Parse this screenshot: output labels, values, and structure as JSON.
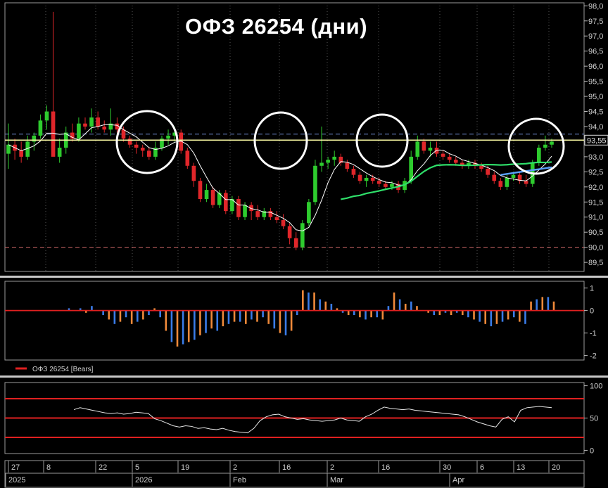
{
  "chart_data": {
    "title": "ОФЗ 26254 (дни)",
    "type": "candlestick",
    "price_panel": {
      "y_ticks": [
        "98,0",
        "97,5",
        "97,0",
        "96,5",
        "96,0",
        "95,5",
        "95,0",
        "94,5",
        "94,0",
        "93,5",
        "93,0",
        "92,5",
        "92,0",
        "91,5",
        "91,0",
        "90,5",
        "90,0",
        "89,5"
      ],
      "last_price_label": "93,55",
      "ylim": [
        89.2,
        98.1
      ],
      "resistance_level": 93.55,
      "dashed_levels": [
        93.75,
        90.0
      ],
      "candles": [
        [
          93.1,
          94.1,
          92.6,
          93.4
        ],
        [
          93.4,
          93.6,
          92.9,
          93.2
        ],
        [
          93.2,
          93.5,
          92.8,
          93.0
        ],
        [
          93.0,
          93.7,
          92.9,
          93.5
        ],
        [
          93.5,
          93.8,
          93.2,
          93.7
        ],
        [
          93.7,
          94.4,
          93.6,
          94.2
        ],
        [
          94.2,
          94.7,
          93.9,
          94.5
        ],
        [
          94.5,
          97.8,
          93.8,
          93.0
        ],
        [
          93.0,
          93.6,
          92.8,
          93.3
        ],
        [
          93.3,
          94.0,
          93.1,
          93.8
        ],
        [
          93.8,
          94.1,
          93.5,
          93.6
        ],
        [
          93.6,
          94.3,
          93.5,
          94.1
        ],
        [
          94.1,
          94.3,
          93.9,
          94.0
        ],
        [
          94.0,
          94.6,
          93.8,
          94.3
        ],
        [
          94.3,
          94.5,
          93.9,
          94.0
        ],
        [
          94.0,
          94.2,
          93.8,
          93.9
        ],
        [
          93.9,
          94.6,
          93.7,
          94.1
        ],
        [
          94.1,
          94.3,
          93.8,
          93.9
        ],
        [
          93.9,
          94.0,
          93.5,
          93.6
        ],
        [
          93.6,
          93.7,
          93.3,
          93.4
        ],
        [
          93.4,
          93.5,
          93.1,
          93.3
        ],
        [
          93.3,
          93.4,
          93.0,
          93.2
        ],
        [
          93.2,
          93.3,
          92.9,
          93.0
        ],
        [
          93.0,
          93.5,
          92.9,
          93.3
        ],
        [
          93.3,
          93.7,
          93.2,
          93.6
        ],
        [
          93.6,
          93.9,
          93.4,
          93.7
        ],
        [
          93.7,
          94.0,
          93.5,
          93.8
        ],
        [
          93.8,
          93.9,
          93.1,
          93.2
        ],
        [
          93.2,
          93.3,
          92.6,
          92.7
        ],
        [
          92.7,
          92.8,
          92.0,
          92.2
        ],
        [
          92.2,
          92.3,
          91.5,
          91.6
        ],
        [
          91.6,
          92.1,
          91.5,
          91.9
        ],
        [
          91.9,
          92.0,
          91.3,
          91.4
        ],
        [
          91.4,
          91.9,
          91.3,
          91.8
        ],
        [
          91.8,
          91.9,
          91.1,
          91.2
        ],
        [
          91.2,
          91.7,
          91.1,
          91.6
        ],
        [
          91.6,
          91.7,
          90.9,
          91.0
        ],
        [
          91.0,
          91.5,
          90.9,
          91.4
        ],
        [
          91.4,
          91.5,
          90.9,
          91.2
        ],
        [
          91.2,
          91.4,
          90.9,
          91.0
        ],
        [
          91.0,
          91.3,
          90.9,
          91.2
        ],
        [
          91.2,
          91.3,
          90.9,
          91.0
        ],
        [
          91.0,
          91.2,
          90.8,
          90.9
        ],
        [
          90.9,
          91.1,
          90.6,
          90.7
        ],
        [
          90.7,
          90.8,
          90.1,
          90.3
        ],
        [
          90.3,
          90.5,
          89.9,
          90.0
        ],
        [
          90.0,
          90.9,
          89.9,
          90.8
        ],
        [
          90.8,
          91.6,
          90.7,
          91.5
        ],
        [
          91.5,
          92.9,
          91.4,
          92.7
        ],
        [
          92.7,
          94.0,
          92.5,
          92.8
        ],
        [
          92.8,
          93.0,
          92.6,
          92.9
        ],
        [
          92.9,
          93.2,
          92.7,
          93.0
        ],
        [
          93.0,
          93.1,
          92.7,
          92.8
        ],
        [
          92.8,
          92.9,
          92.5,
          92.6
        ],
        [
          92.6,
          92.7,
          92.3,
          92.4
        ],
        [
          92.4,
          92.5,
          92.1,
          92.2
        ],
        [
          92.2,
          92.4,
          92.0,
          92.3
        ],
        [
          92.3,
          92.4,
          92.1,
          92.2
        ],
        [
          92.2,
          92.3,
          92.0,
          92.1
        ],
        [
          92.1,
          92.2,
          91.9,
          92.0
        ],
        [
          92.0,
          92.2,
          91.9,
          92.1
        ],
        [
          92.1,
          92.2,
          91.8,
          91.9
        ],
        [
          91.9,
          92.3,
          91.8,
          92.2
        ],
        [
          92.2,
          93.2,
          92.1,
          93.0
        ],
        [
          93.0,
          93.7,
          92.9,
          93.5
        ],
        [
          93.5,
          93.6,
          93.1,
          93.2
        ],
        [
          93.2,
          93.5,
          93.0,
          93.3
        ],
        [
          93.3,
          93.5,
          93.0,
          93.1
        ],
        [
          93.1,
          93.2,
          92.9,
          93.0
        ],
        [
          93.0,
          93.1,
          92.8,
          92.9
        ],
        [
          92.9,
          93.0,
          92.7,
          92.8
        ],
        [
          92.8,
          92.9,
          92.6,
          92.7
        ],
        [
          92.7,
          92.9,
          92.6,
          92.8
        ],
        [
          92.8,
          92.9,
          92.6,
          92.7
        ],
        [
          92.7,
          92.8,
          92.5,
          92.6
        ],
        [
          92.6,
          92.7,
          92.3,
          92.4
        ],
        [
          92.4,
          92.5,
          92.1,
          92.2
        ],
        [
          92.2,
          92.3,
          91.9,
          92.0
        ],
        [
          92.0,
          92.4,
          91.9,
          92.3
        ],
        [
          92.3,
          92.5,
          92.2,
          92.4
        ],
        [
          92.4,
          92.5,
          92.1,
          92.2
        ],
        [
          92.2,
          92.4,
          92.0,
          92.1
        ],
        [
          92.1,
          92.9,
          92.0,
          92.8
        ],
        [
          92.8,
          93.4,
          92.7,
          93.3
        ],
        [
          93.3,
          93.7,
          93.2,
          93.4
        ],
        [
          93.4,
          93.6,
          93.3,
          93.5
        ]
      ],
      "circled_zones": [
        "Jan",
        "Feb 16",
        "Mar 16",
        "Apr 20"
      ]
    },
    "bears_panel": {
      "legend": "ОФЗ 26254 [Bears]",
      "y_ticks": [
        "1",
        "0",
        "-1",
        "-2"
      ],
      "ylim": [
        -2.2,
        1.3
      ],
      "values": [
        0.1,
        0.0,
        0.1,
        -0.1,
        0.2,
        0.0,
        -0.2,
        -0.4,
        -0.6,
        -0.5,
        -0.3,
        -0.6,
        -0.5,
        -0.4,
        -0.2,
        0.1,
        -0.3,
        -0.9,
        -1.4,
        -1.6,
        -1.5,
        -1.4,
        -1.3,
        -1.1,
        -1.0,
        -0.8,
        -0.9,
        -0.7,
        -0.6,
        -0.5,
        -0.5,
        -0.6,
        -0.4,
        -0.5,
        -0.3,
        -0.6,
        -0.8,
        -1.0,
        -1.1,
        -0.9,
        -0.2,
        0.9,
        0.8,
        0.8,
        0.5,
        0.4,
        0.3,
        0.1,
        -0.1,
        -0.2,
        -0.2,
        -0.3,
        -0.4,
        -0.3,
        -0.3,
        -0.4,
        0.2,
        0.8,
        0.5,
        0.3,
        0.4,
        0.2,
        0.0,
        -0.1,
        -0.2,
        -0.2,
        -0.1,
        -0.2,
        -0.1,
        -0.2,
        -0.3,
        -0.4,
        -0.5,
        -0.6,
        -0.7,
        -0.6,
        -0.5,
        -0.4,
        -0.3,
        -0.5,
        -0.6,
        0.4,
        0.5,
        0.6,
        0.6,
        0.4
      ]
    },
    "rsi_panel": {
      "y_ticks": [
        "100",
        "50",
        "0"
      ],
      "ylim": [
        -5,
        105
      ],
      "levels": [
        80,
        50,
        20
      ],
      "values": [
        63,
        66,
        64,
        62,
        60,
        58,
        57,
        58,
        56,
        57,
        59,
        58,
        57,
        49,
        46,
        42,
        38,
        36,
        38,
        37,
        34,
        35,
        33,
        32,
        34,
        31,
        29,
        28,
        27,
        34,
        46,
        52,
        55,
        56,
        52,
        50,
        48,
        49,
        47,
        46,
        45,
        46,
        47,
        50,
        47,
        46,
        45,
        52,
        56,
        62,
        67,
        65,
        64,
        63,
        64,
        62,
        61,
        60,
        59,
        58,
        57,
        56,
        55,
        52,
        48,
        44,
        41,
        38,
        36,
        48,
        52,
        44,
        62,
        66,
        67,
        68,
        67,
        66
      ]
    },
    "x_axis": {
      "day_ticks": [
        "27",
        "8",
        "22",
        "5",
        "19",
        "2",
        "16",
        "2",
        "16",
        "30",
        "6",
        "13",
        "20"
      ],
      "month_ticks": [
        "2025",
        "2026",
        "Feb",
        "Mar",
        "Apr"
      ]
    }
  },
  "colors": {
    "background": "#000000",
    "bull_candle": "#2ecc2e",
    "bear_candle": "#e0262a",
    "level_lines": "#e02020",
    "resistance": "#f5f5a0",
    "ma_fast": "#ffffff",
    "ma_slow": "#2fe06a",
    "bears_blue": "#3a7ce8",
    "bears_orange": "#f08a3a"
  }
}
